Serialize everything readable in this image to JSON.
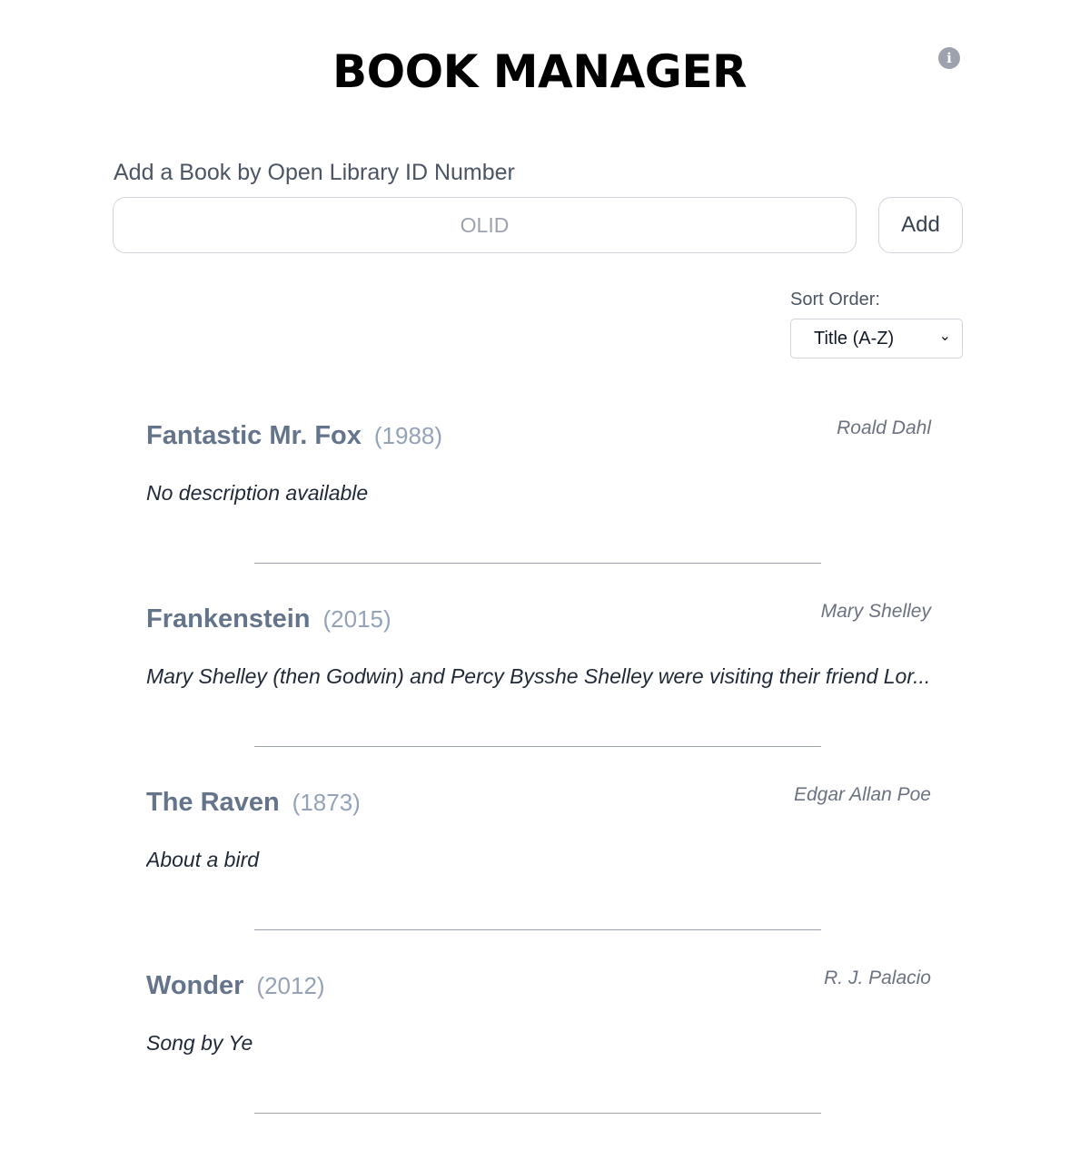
{
  "header": {
    "title": "BOOK MANAGER",
    "info_icon": "info-icon"
  },
  "add_form": {
    "label": "Add a Book by Open Library ID Number",
    "input_value": "",
    "input_placeholder": "OLID",
    "button_label": "Add"
  },
  "sort": {
    "label": "Sort Order:",
    "selected": "Title (A-Z)"
  },
  "books": [
    {
      "title": "Fantastic Mr. Fox",
      "year": "(1988)",
      "author": "Roald Dahl",
      "description": "No description available"
    },
    {
      "title": "Frankenstein",
      "year": "(2015)",
      "author": "Mary Shelley",
      "description": "Mary Shelley (then Godwin) and Percy Bysshe Shelley were visiting their friend Lor..."
    },
    {
      "title": "The Raven",
      "year": "(1873)",
      "author": "Edgar Allan Poe",
      "description": "About a bird"
    },
    {
      "title": "Wonder",
      "year": "(2012)",
      "author": "R. J. Palacio",
      "description": "Song by Ye"
    }
  ],
  "colors": {
    "title_text": "#000000",
    "book_title": "#64748b",
    "year_text": "#94a3b8",
    "divider": "#9ca3af"
  }
}
